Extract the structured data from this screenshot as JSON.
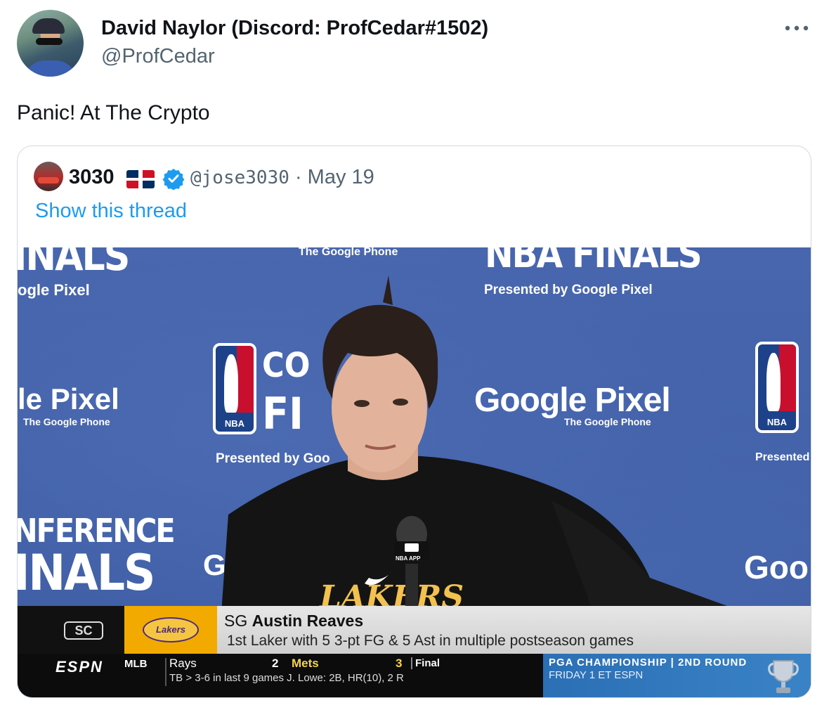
{
  "tweet": {
    "author_name": "David Naylor (Discord: ProfCedar#1502)",
    "author_handle": "@ProfCedar",
    "more_icon": "more-horizontal-icon",
    "text": "Panic! At The Crypto"
  },
  "quote": {
    "name": "3030",
    "flag_icon": "dominican-republic-flag-icon",
    "verified_icon": "verified-badge-icon",
    "handle": "@jose3030",
    "separator": " · ",
    "date": "May 19",
    "show_thread": "Show this thread"
  },
  "media": {
    "backdrop": {
      "finals_a": "INALS",
      "pixel_a": "ogle Pixel",
      "phone_top": "The Google Phone",
      "finals_b": "NBA FINALS",
      "presented_b": "Presented by Google Pixel",
      "pixel_c": "le Pixel",
      "phone_c": "The Google Phone",
      "conf_d": "CO",
      "fi_d": "FI",
      "presented_d": "Presented by Goo",
      "pixel_e": "Google Pixel",
      "phone_e": "The Google Phone",
      "presented_f": "Presented by",
      "conference_g": "NFERENCE",
      "finals_g": "INALS",
      "g_h": "G",
      "goo_i": "Goo",
      "nba_label": "NBA",
      "mic_label": "NBA APP"
    },
    "lower_third": {
      "network_badge": "SC",
      "team_logo": "Lakers",
      "position": "SG",
      "player_name": "Austin Reaves",
      "stat": "1st Laker with 5 3-pt FG & 5 Ast in multiple postseason games"
    },
    "ticker": {
      "network": "ESPN",
      "league": "MLB",
      "away_team": "Rays",
      "away_score": "2",
      "home_team": "Mets",
      "home_score": "3",
      "status": "Final",
      "line2": "TB > 3-6 in last 9 games    J. Lowe: 2B, HR(10), 2 R",
      "promo_line1": "PGA CHAMPIONSHIP | 2ND ROUND",
      "promo_line2": "FRIDAY 1 ET  ESPN",
      "trophy_icon": "trophy-icon"
    }
  },
  "colors": {
    "link_blue": "#1d9bf0",
    "handle_gray": "#536471",
    "backdrop_blue": "#3f5fa6",
    "lakers_gold": "#f2a900"
  }
}
